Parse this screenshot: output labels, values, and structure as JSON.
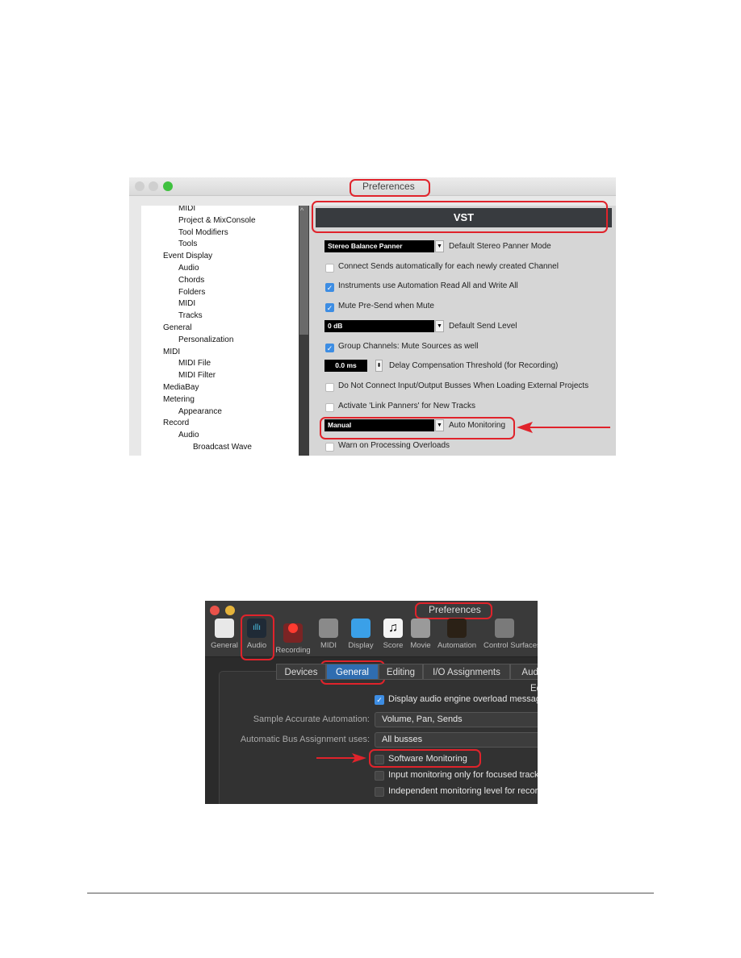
{
  "screenshot1": {
    "window_title": "Preferences",
    "tree": [
      {
        "label": "MIDI",
        "level": 2
      },
      {
        "label": "Project & MixConsole",
        "level": 2
      },
      {
        "label": "Tool Modifiers",
        "level": 2
      },
      {
        "label": "Tools",
        "level": 2
      },
      {
        "label": "Event Display",
        "level": 1
      },
      {
        "label": "Audio",
        "level": 2
      },
      {
        "label": "Chords",
        "level": 2
      },
      {
        "label": "Folders",
        "level": 2
      },
      {
        "label": "MIDI",
        "level": 2
      },
      {
        "label": "Tracks",
        "level": 2
      },
      {
        "label": "General",
        "level": 1
      },
      {
        "label": "Personalization",
        "level": 2
      },
      {
        "label": "MIDI",
        "level": 1
      },
      {
        "label": "MIDI File",
        "level": 2
      },
      {
        "label": "MIDI Filter",
        "level": 2
      },
      {
        "label": "MediaBay",
        "level": 1
      },
      {
        "label": "Metering",
        "level": 1
      },
      {
        "label": "Appearance",
        "level": 2
      },
      {
        "label": "Record",
        "level": 1
      },
      {
        "label": "Audio",
        "level": 2
      },
      {
        "label": "Broadcast Wave",
        "level": 3
      }
    ],
    "section_title": "VST",
    "rows": [
      {
        "type": "select",
        "value": "Stereo Balance Panner",
        "label": "Default Stereo Panner Mode"
      },
      {
        "type": "checkbox",
        "checked": false,
        "label": "Connect Sends automatically for each newly created Channel"
      },
      {
        "type": "checkbox",
        "checked": true,
        "label": "Instruments use Automation Read All and Write All"
      },
      {
        "type": "checkbox",
        "checked": true,
        "label": "Mute Pre-Send when Mute"
      },
      {
        "type": "select",
        "value": "0 dB",
        "label": "Default Send Level"
      },
      {
        "type": "checkbox",
        "checked": true,
        "label": "Group Channels: Mute Sources as well"
      },
      {
        "type": "spinner",
        "value": "0.0 ms",
        "label": "Delay Compensation Threshold (for Recording)"
      },
      {
        "type": "checkbox",
        "checked": false,
        "label": "Do Not Connect Input/Output Busses When Loading External Projects"
      },
      {
        "type": "checkbox",
        "checked": false,
        "label": "Activate 'Link Panners' for New Tracks"
      },
      {
        "type": "select",
        "value": "Manual",
        "label": "Auto Monitoring",
        "highlighted": true
      },
      {
        "type": "checkbox",
        "checked": false,
        "label": "Warn on Processing Overloads"
      }
    ]
  },
  "screenshot2": {
    "window_title": "Preferences",
    "toolbar": [
      {
        "label": "General",
        "icon": "general-switch-icon",
        "color": "#e8e8e8"
      },
      {
        "label": "Audio",
        "icon": "audio-waveform-icon",
        "color": "#1f2a36",
        "selected": true
      },
      {
        "label": "Recording",
        "icon": "record-icon",
        "color": "#7a2424"
      },
      {
        "label": "MIDI",
        "icon": "midi-port-icon",
        "color": "#8a8a8a"
      },
      {
        "label": "Display",
        "icon": "monitor-icon",
        "color": "#3aa0e8"
      },
      {
        "label": "Score",
        "icon": "music-note-icon",
        "color": "#f4f4f4"
      },
      {
        "label": "Movie",
        "icon": "camera-icon",
        "color": "#9a9a9a"
      },
      {
        "label": "Automation",
        "icon": "automation-icon",
        "color": "#2b2116"
      },
      {
        "label": "Control Surfaces",
        "icon": "faders-icon",
        "color": "#7a7a7a"
      }
    ],
    "tabs": [
      {
        "label": "Devices"
      },
      {
        "label": "General",
        "active": true
      },
      {
        "label": "Editing"
      },
      {
        "label": "I/O Assignments"
      },
      {
        "label": "Audio File Editor"
      }
    ],
    "display_overload": {
      "checked": true,
      "label": "Display audio engine overload message"
    },
    "sample_accurate": {
      "label": "Sample Accurate Automation:",
      "value": "Volume, Pan, Sends"
    },
    "bus_assignment": {
      "label": "Automatic Bus Assignment uses:",
      "value": "All busses"
    },
    "checks": [
      {
        "checked": false,
        "label": "Software Monitoring",
        "highlighted": true
      },
      {
        "checked": false,
        "label": "Input monitoring only for focused track"
      },
      {
        "checked": false,
        "label": "Independent monitoring level for record-enabled tracks"
      }
    ]
  },
  "colors": {
    "highlight": "#e0232b",
    "checkbox_blue": "#3d8de3",
    "tab_active": "#2f6db0"
  }
}
